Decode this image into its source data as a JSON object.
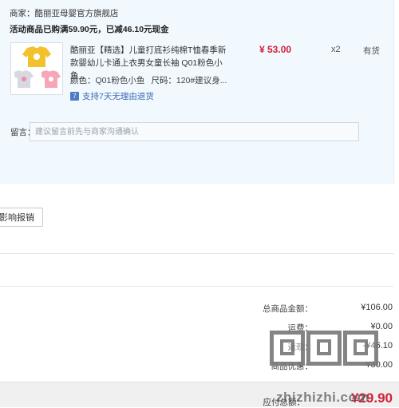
{
  "shop": {
    "label": "商家：",
    "name": "酷丽亚母婴官方旗舰店"
  },
  "promo": {
    "text": "活动商品已购满59.90元，已减46.10元现金"
  },
  "product": {
    "title": "酷丽亚【精选】儿童打底衫纯棉T恤春季新款婴幼儿卡通上衣男女童长袖 Q01粉色小鱼",
    "price": "¥ 53.00",
    "qty": "x2",
    "stock": "有货",
    "color_label": "颜色：",
    "color_value": "Q01粉色小鱼",
    "size_label": "尺码：",
    "size_value": "120#建议身...",
    "return_badge": "7",
    "return_text": "支持7天无理由退货"
  },
  "message": {
    "label": "留言：",
    "placeholder": "建议留言前先与商家沟通确认"
  },
  "report_button": "影响报销",
  "summary": {
    "total_label": "总商品金额：",
    "total_value": "¥106.00",
    "shipping_label": "运费：",
    "shipping_value": "¥0.00",
    "rebate_label": "返现：",
    "rebate_value": "-¥46.10",
    "discount_label": "商品优惠：",
    "discount_value": "-¥30.00",
    "pay_label": "应付总额：",
    "pay_value": "¥29.90"
  },
  "watermark": {
    "text": "zhizhizhi.com",
    "icon": "zhizhizhi-logo-icon"
  },
  "colors": {
    "price_red": "#d41f36",
    "panel_bg": "#f1f8fe",
    "link_blue": "#3a69b2"
  }
}
